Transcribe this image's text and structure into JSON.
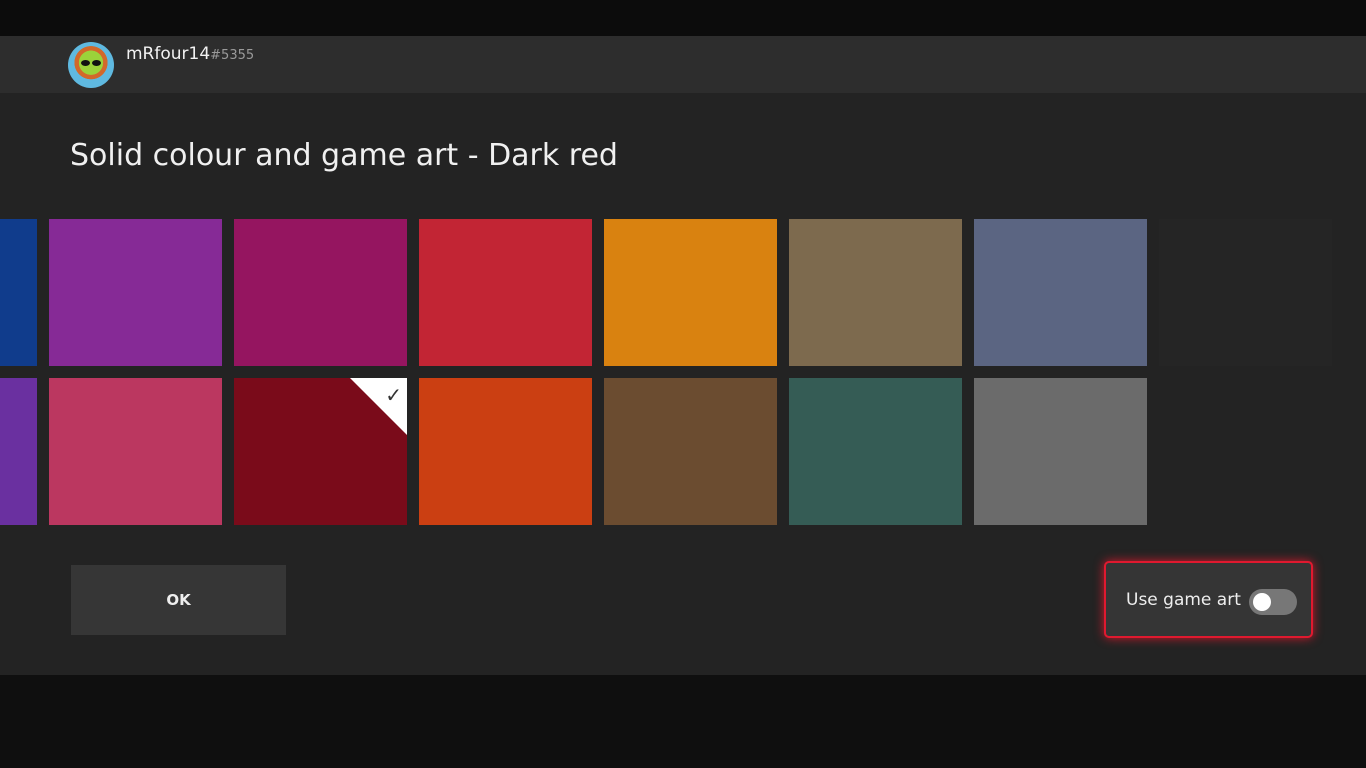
{
  "user": {
    "gamertag": "mRfour14",
    "suffix": "#5355"
  },
  "title": "Solid colour and game art - Dark red",
  "colors": {
    "row1": [
      "#103c8c",
      "#862a96",
      "#951560",
      "#c22534",
      "#d98210",
      "#7d6a4e",
      "#5b6582",
      "#272727"
    ],
    "row2": [
      "#6a30a0",
      "#bb3760",
      "#7a0b1a",
      "#cb3f12",
      "#6b4c30",
      "#355c55",
      "#6b6b6b"
    ]
  },
  "selected": "Dark red",
  "check_glyph": "✓",
  "ok_label": "OK",
  "game_art": {
    "label": "Use game art",
    "on": false
  }
}
